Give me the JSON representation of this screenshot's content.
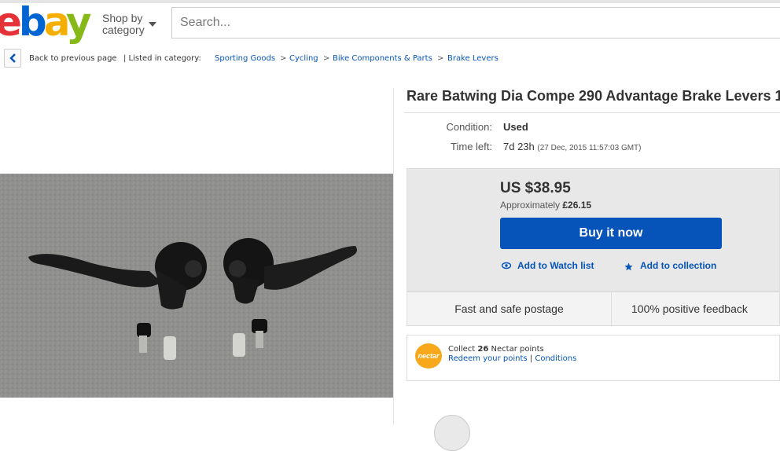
{
  "header": {
    "logo_text": "ebay",
    "shop_by_line1": "Shop by",
    "shop_by_line2": "category",
    "search_placeholder": "Search..."
  },
  "breadcrumb": {
    "back_label": "Back to previous page",
    "listed_in": "| Listed in category:",
    "items": [
      "Sporting Goods",
      "Cycling",
      "Bike Components & Parts",
      "Brake Levers"
    ],
    "separator": ">"
  },
  "item": {
    "title": "Rare Batwing Dia Compe 290 Advantage Brake Levers 1",
    "condition_label": "Condition:",
    "condition_value": "Used",
    "time_left_label": "Time left:",
    "time_left_value": "7d 23h",
    "time_left_detail": "(27 Dec, 2015   11:57:03 GMT)"
  },
  "buy": {
    "price": "US $38.95",
    "approx_label": "Approximately",
    "approx_value": "£26.15",
    "buy_now_label": "Buy it now",
    "watch_label": "Add to Watch list",
    "collection_label": "Add to collection"
  },
  "features": {
    "postage": "Fast and safe postage",
    "feedback": "100% positive feedback"
  },
  "nectar": {
    "logo": "nectar",
    "collect_prefix": "Collect",
    "points": "26",
    "collect_suffix": "Nectar points",
    "redeem": "Redeem your points",
    "pipe": "|",
    "conditions": "Conditions"
  },
  "colors": {
    "link": "#0654ba",
    "buy_button": "#0654ba",
    "logo_e": "#e53238",
    "logo_b": "#0064d2",
    "logo_a": "#f5af02",
    "logo_y": "#86b817"
  }
}
